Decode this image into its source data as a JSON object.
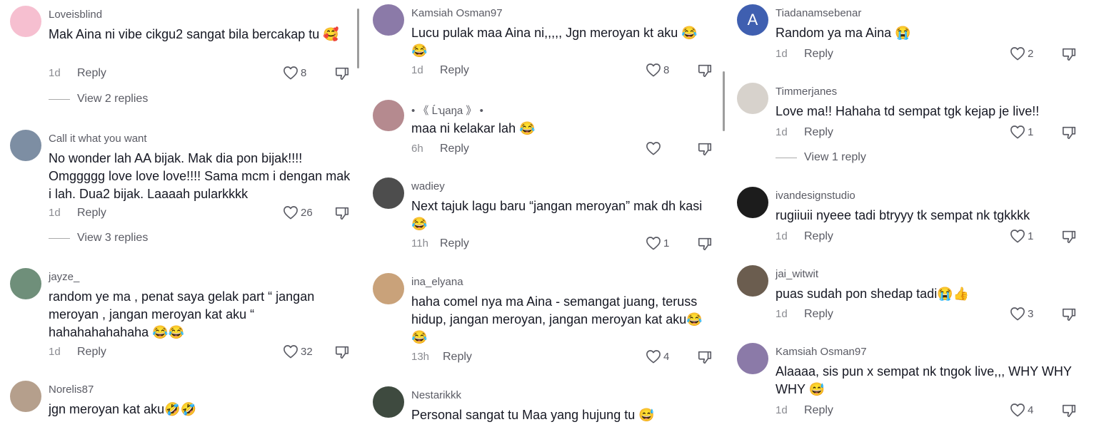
{
  "col1": [
    {
      "user": "Loveisblind",
      "text": "Mak Aina ni vibe cikgu2 sangat bila bercakap tu 🥰",
      "time": "1d",
      "reply": "Reply",
      "likes": "8",
      "view": "View 2 replies",
      "avatar_color": "#f6bfd0"
    },
    {
      "user": "Call it what you want",
      "text": "No wonder lah AA bijak. Mak dia pon bijak!!!! Omggggg love love love!!!! Sama mcm i dengan mak i lah. Dua2 bijak. Laaaah pularkkkk",
      "time": "1d",
      "reply": "Reply",
      "likes": "26",
      "view": "View 3 replies",
      "avatar_color": "#7d8ea3"
    },
    {
      "user": "jayze_",
      "text": "random ye ma , penat saya gelak part “ jangan meroyan , jangan meroyan kat aku “ hahahahahahaha 😂😂",
      "time": "1d",
      "reply": "Reply",
      "likes": "32",
      "avatar_color": "#6f8f7a"
    },
    {
      "user": "Norelis87",
      "text": "jgn meroyan kat aku🤣🤣",
      "avatar_color": "#b59f8c"
    }
  ],
  "col2": [
    {
      "user": "Kamsiah Osman97",
      "text": "Lucu pulak maa Aina ni,,,,, Jgn meroyan kt aku 😂😂",
      "time": "1d",
      "reply": "Reply",
      "likes": "8",
      "avatar_color": "#8b7aa8"
    },
    {
      "user": "• 《 Ĺʮaŋa 》 •",
      "text": "maa ni kelakar lah 😂",
      "time": "6h",
      "reply": "Reply",
      "likes": "",
      "avatar_color": "#b58a8f"
    },
    {
      "user": "wadiey",
      "text": "Next tajuk lagu baru “jangan meroyan” mak dh kasi😂",
      "time": "11h",
      "reply": "Reply",
      "likes": "1",
      "avatar_color": "#4d4d4d"
    },
    {
      "user": "ina_elyana",
      "text": "haha comel nya ma Aina - semangat juang, teruss hidup, jangan meroyan, jangan meroyan kat aku😂😂",
      "time": "13h",
      "reply": "Reply",
      "likes": "4",
      "avatar_color": "#c9a27a"
    },
    {
      "user": "Nestarikkk",
      "text": "Personal sangat tu Maa yang hujung tu 😅",
      "avatar_color": "#3e4a3f"
    }
  ],
  "col3": [
    {
      "user": "Tiadanamsebenar",
      "text": "Random ya ma Aina 😭",
      "time": "1d",
      "reply": "Reply",
      "likes": "2",
      "avatar_letter": "A",
      "avatar_color": "#3f5fb0"
    },
    {
      "user": "Timmerjanes",
      "text": "Love ma!! Hahaha td sempat tgk kejap je live!!",
      "time": "1d",
      "reply": "Reply",
      "likes": "1",
      "view": "View 1 reply",
      "avatar_color": "#d7d2cc"
    },
    {
      "user": "ivandesignstudio",
      "text": "rugiiuii nyeee tadi btryyy tk sempat nk tgkkkk",
      "time": "1d",
      "reply": "Reply",
      "likes": "1",
      "avatar_color": "#1c1c1c"
    },
    {
      "user": "jai_witwit",
      "text": "puas sudah pon shedap tadi😭👍",
      "time": "1d",
      "reply": "Reply",
      "likes": "3",
      "avatar_color": "#6b5d4f"
    },
    {
      "user": "Kamsiah Osman97",
      "text": "Alaaaa, sis pun x sempat nk tngok live,,, WHY WHY WHY 😅",
      "time": "1d",
      "reply": "Reply",
      "likes": "4",
      "avatar_color": "#8b7aa8"
    }
  ],
  "icons": {
    "like": "heart-outline-icon",
    "dislike": "thumbs-down-icon"
  }
}
